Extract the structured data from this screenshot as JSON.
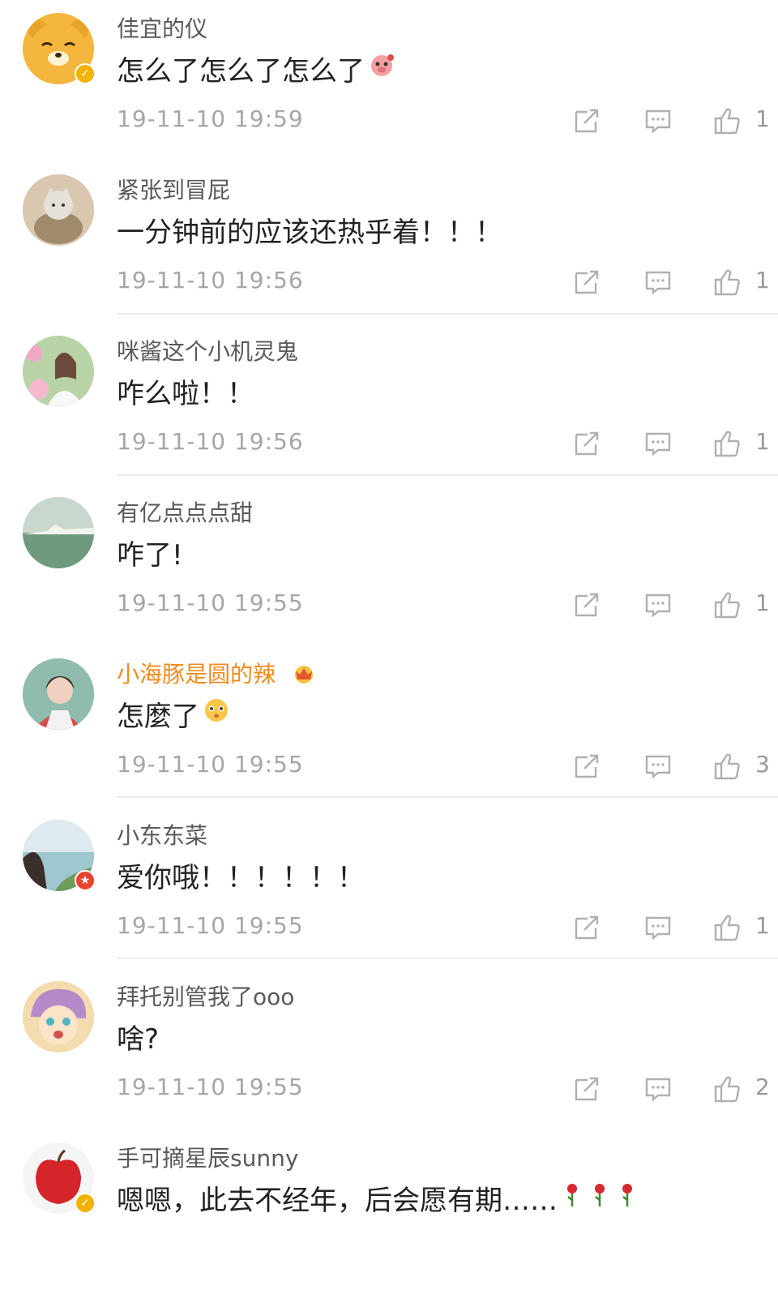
{
  "comments": [
    {
      "user": "佳宜的仪",
      "text": "怎么了怎么了怎么了",
      "time": "19-11-10 19:59",
      "likes": "1",
      "emoji": "pig-emoji",
      "badge": "verified-gold"
    },
    {
      "user": "紧张到冒屁",
      "text": "一分钟前的应该还热乎着！！！",
      "time": "19-11-10 19:56",
      "likes": "1"
    },
    {
      "user": "咪酱这个小机灵鬼",
      "text": "咋么啦！！",
      "time": "19-11-10 19:56",
      "likes": "1"
    },
    {
      "user": "有亿点点点甜",
      "text": "咋了!",
      "time": "19-11-10 19:55",
      "likes": "1"
    },
    {
      "user": "小海豚是圆的辣",
      "text": "怎麼了",
      "time": "19-11-10 19:55",
      "likes": "3",
      "emoji": "worried-face-emoji",
      "vip": true
    },
    {
      "user": "小东东菜",
      "text": "爱你哦！！！！！！",
      "time": "19-11-10 19:55",
      "likes": "1",
      "badge": "red-star"
    },
    {
      "user": "拜托别管我了ooo",
      "text": "啥?",
      "time": "19-11-10 19:55",
      "likes": "2"
    },
    {
      "user": "手可摘星辰sunny",
      "text": "嗯嗯，此去不经年，后会愿有期……",
      "emoji": "rose-emoji ×3",
      "badge": "verified-gold"
    }
  ],
  "colors": {
    "accent": "#f08b1e",
    "icon": "#b0b0b0",
    "text": "#222222"
  }
}
